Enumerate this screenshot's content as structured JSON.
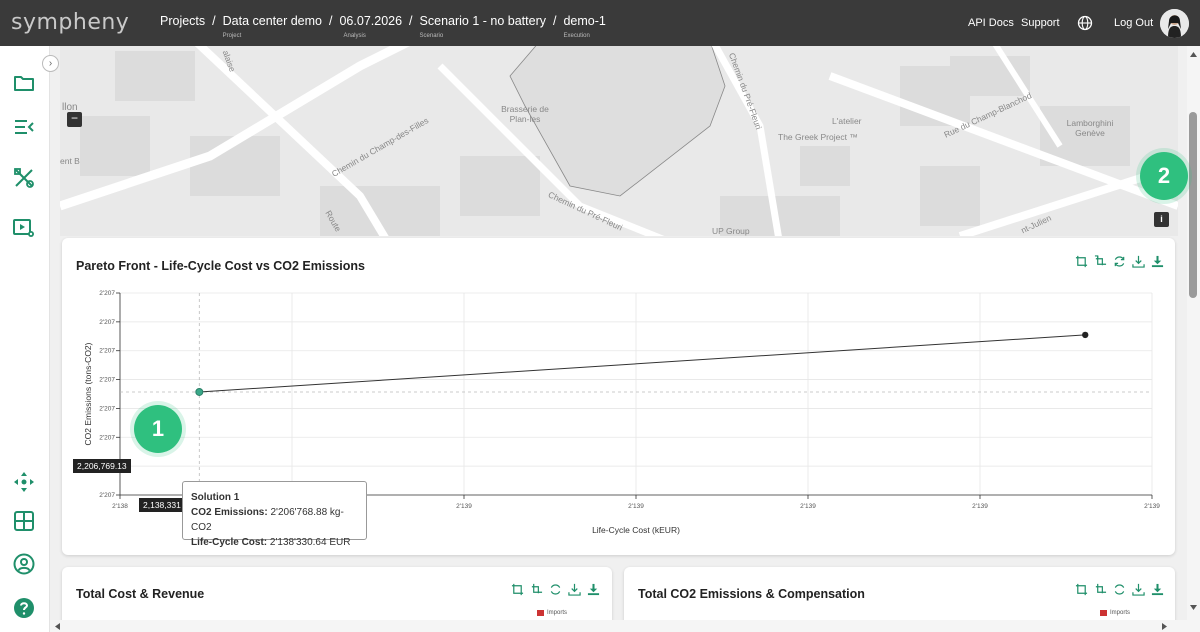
{
  "app": {
    "logo": "sympheny"
  },
  "breadcrumb": [
    {
      "label": "Projects",
      "sub": ""
    },
    {
      "label": "Data center demo",
      "sub": "Project"
    },
    {
      "label": "06.07.2026",
      "sub": "Analysis"
    },
    {
      "label": "Scenario 1 - no battery",
      "sub": "Scenario"
    },
    {
      "label": "demo-1",
      "sub": "Execution"
    }
  ],
  "header": {
    "api_docs": "API Docs",
    "support": "Support",
    "logout": "Log Out"
  },
  "map": {
    "labels": [
      "llon",
      "ent B",
      "alaise",
      "Chemin du Champ-des-Filles",
      "Route",
      "Brasserie de Plan-les",
      "Chemin du Pré-Fleuri",
      "Chemin du Pré-Fleuri",
      "L'atelier",
      "The Greek Project ™",
      "Rue du Champ-Blanchod",
      "Lamborghini Genève",
      "UP Group",
      "nt-Julien"
    ],
    "zoom_out": "−",
    "info": "i"
  },
  "markers": {
    "one": "1",
    "two": "2"
  },
  "pareto": {
    "title": "Pareto Front - Life-Cycle Cost vs CO2 Emissions",
    "tooltip": {
      "title": "Solution 1",
      "co2_label": "CO2 Emissions:",
      "co2_value": "2'206'768.88 kg-CO2",
      "cost_label": "Life-Cycle Cost:",
      "cost_value": "2'138'330.64 EUR"
    },
    "y_pointer": "2,206,769.13",
    "x_pointer": "2,138,331"
  },
  "chart_data": {
    "type": "line",
    "title": "Pareto Front - Life-Cycle Cost vs CO2 Emissions",
    "xlabel": "Life-Cycle Cost (kEUR)",
    "ylabel": "CO2 Emissions (tons-CO2)",
    "x_ticks": [
      "2'138",
      "2'139",
      "2'139",
      "2'139",
      "2'139",
      "2'139",
      "2'139"
    ],
    "y_ticks": [
      "2'207",
      "2'207",
      "2'207",
      "2'207",
      "2'207",
      "2'207",
      "2'207",
      "2'207"
    ],
    "x_range": [
      2138.2,
      2139.9
    ],
    "y_range": [
      2206.7648,
      2206.7728
    ],
    "series": [
      {
        "x": [
          2138.33064,
          2139.79
        ],
        "y": [
          2206.76888,
          2206.77114
        ]
      }
    ],
    "grid": true
  },
  "cards": {
    "cost_title": "Total Cost & Revenue",
    "co2_title": "Total CO2 Emissions & Compensation",
    "legend_imports": "Imports"
  },
  "colors": {
    "accent": "#2fc07f",
    "header": "#3a3a3a",
    "icon": "#1f8f6a"
  }
}
